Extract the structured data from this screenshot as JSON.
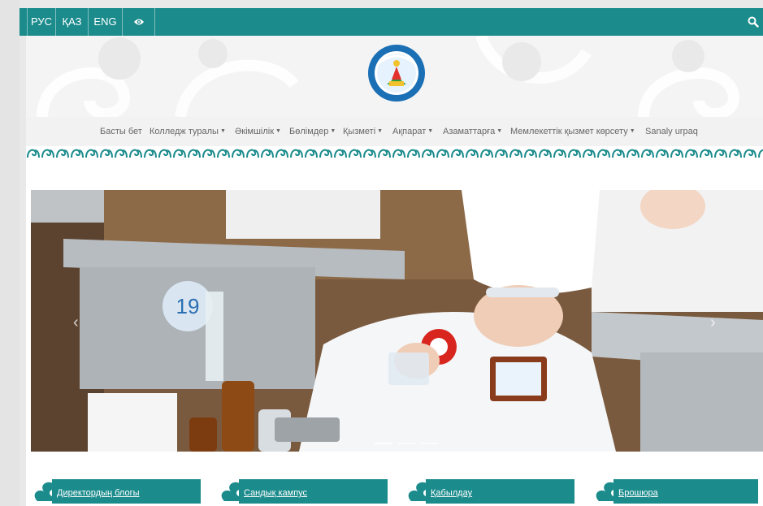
{
  "topbar": {
    "languages": [
      {
        "label": "РУС"
      },
      {
        "label": "ҚАЗ"
      },
      {
        "label": "ENG"
      }
    ],
    "accessibility_icon": "eye-icon",
    "search_icon": "search-icon",
    "accent_color": "#1b8b8c"
  },
  "header": {
    "logo_icon": "college-logo-emblem"
  },
  "nav": {
    "items": [
      {
        "label": "Басты бет",
        "dropdown": false
      },
      {
        "label": "Колледж туралы",
        "dropdown": true
      },
      {
        "label": "Әкімшілік",
        "dropdown": true
      },
      {
        "label": "Бөлімдер",
        "dropdown": true
      },
      {
        "label": "Қызметі",
        "dropdown": true
      },
      {
        "label": "Ақпарат",
        "dropdown": true
      },
      {
        "label": "Азаматтарға",
        "dropdown": true
      },
      {
        "label": "Мемлекеттік қызмет көрсету",
        "dropdown": true
      },
      {
        "label": "Sanaly urpaq",
        "dropdown": false
      }
    ]
  },
  "slider": {
    "prev_icon": "chevron-left-icon",
    "next_icon": "chevron-right-icon",
    "slide_count": 3,
    "active_slide": 1
  },
  "quick_links": [
    {
      "label": "Директордың блогы",
      "icon": "ornament-icon"
    },
    {
      "label": "Сандық кампус",
      "icon": "ornament-icon"
    },
    {
      "label": "Қабылдау",
      "icon": "ornament-icon"
    },
    {
      "label": "Брошюра",
      "icon": "ornament-icon"
    }
  ]
}
